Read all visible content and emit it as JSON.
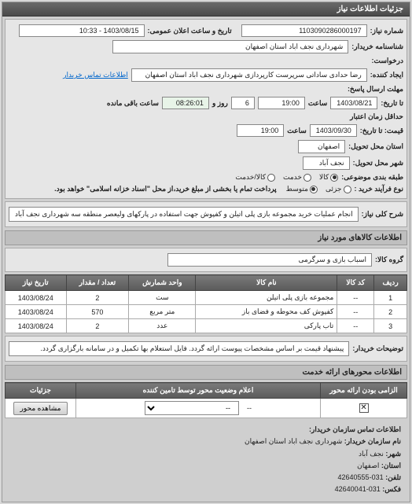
{
  "header": {
    "title": "جزئیات اطلاعات نیاز"
  },
  "info": {
    "need_no_label": "شماره نیاز:",
    "need_no": "1103090286000197",
    "announce_label": "تاریخ و ساعت اعلان عمومی:",
    "announce_value": "1403/08/15 - 10:33",
    "buyer_name_label": "شناسنامه خریدار:",
    "buyer_name": "شهرداری نجف اباد استان اصفهان",
    "request_label": "درخواست:",
    "creator_label": "ایجاد کننده:",
    "creator_value": "رضا حدادی ساداتی سرپرست کارپردازی شهرداری نجف اباد استان اصفهان",
    "contact_link": "اطلاعات تماس خریدار",
    "deadline_send_label": "مهلت ارسال پاسخ:",
    "deadline_label_suffix": "تا تاریخ:",
    "deadline_date": "1403/08/21",
    "time_label": "ساعت",
    "deadline_time": "19:00",
    "remaining_days": "6",
    "remaining_days_label": "روز و",
    "remaining_time": "08:26:01",
    "remaining_label": "ساعت باقی مانده",
    "price_validity_label": "حداقل زمان اعتبار",
    "price_validity_suffix": "قیمت: تا تاریخ:",
    "price_validity_date": "1403/09/30",
    "price_validity_time": "19:00",
    "delivery_province_label": "استان محل تحویل:",
    "delivery_province": "اصفهان",
    "delivery_city_label": "شهر محل تحویل:",
    "delivery_city": "نجف آباد",
    "category_label": "طبقه بندی موضوعی:",
    "category_options": {
      "goods": "کالا",
      "service": "خدمت",
      "mixed": "کالا/خدمت"
    },
    "category_selected": "goods",
    "purchase_type_label": "نوع فرآیند خرید :",
    "purchase_type_options": {
      "small": "جزئی",
      "medium": "متوسط"
    },
    "purchase_type_selected": "medium",
    "payment_note": "پرداخت تمام یا بخشی از مبلغ خرید،از محل \"اسناد خزانه اسلامی\" خواهد بود.",
    "need_desc_label": "شرح کلی نیاز:",
    "need_desc": "انجام عملیات خرید مجموعه بازی پلی اتیلن و کفپوش جهت استفاده در پارکهای ولیعصر منطقه سه شهرداری نجف آباد"
  },
  "goods_header": "اطلاعات کالاهای مورد نیاز",
  "goods_group_label": "گروه کالا:",
  "goods_group": "اسباب بازی و سرگرمی",
  "table": {
    "headers": {
      "row": "ردیف",
      "code": "کد کالا",
      "name": "نام کالا",
      "unit": "واحد شمارش",
      "qty": "تعداد / مقدار",
      "date": "تاریخ نیاز"
    },
    "rows": [
      {
        "row": "1",
        "code": "--",
        "name": "مجموعه بازی پلی اتیلن",
        "unit": "ست",
        "qty": "2",
        "date": "1403/08/24"
      },
      {
        "row": "2",
        "code": "--",
        "name": "کفپوش کف محوطه و فضای باز",
        "unit": "متر مربع",
        "qty": "570",
        "date": "1403/08/24"
      },
      {
        "row": "3",
        "code": "--",
        "name": "تاب پارکی",
        "unit": "عدد",
        "qty": "2",
        "date": "1403/08/24"
      }
    ]
  },
  "buyer_notes_label": "توضیحات خریدار:",
  "buyer_notes": "پیشنهاد قیمت بر اساس مشخصات پیوست ارائه گردد. فایل استعلام بها تکمیل و در سامانه بارگزاری گردد.",
  "axis_header": "اطلاعات محورهای ارائه خدمت",
  "axis_table": {
    "headers": {
      "mandatory": "الزامی بودن ارائه محور",
      "status": "اعلام وضعیت محور توسط تامین کننده",
      "details": "جزئیات"
    },
    "row": {
      "mandatory_checked": true,
      "status": "--",
      "select_value": "--",
      "details_btn": "مشاهده محور"
    }
  },
  "contact": {
    "header": "اطلاعات تماس سازمان خریدار:",
    "org_label": "نام سازمان خریدار:",
    "org": "شهرداری نجف اباد استان اصفهان",
    "city_label": "شهر:",
    "city": "نجف آباد",
    "province_label": "استان:",
    "province": "اصفهان",
    "phone_label": "تلفن:",
    "phone": "031-42640555",
    "fax_label": "فکس:",
    "fax": "031-42640041"
  }
}
